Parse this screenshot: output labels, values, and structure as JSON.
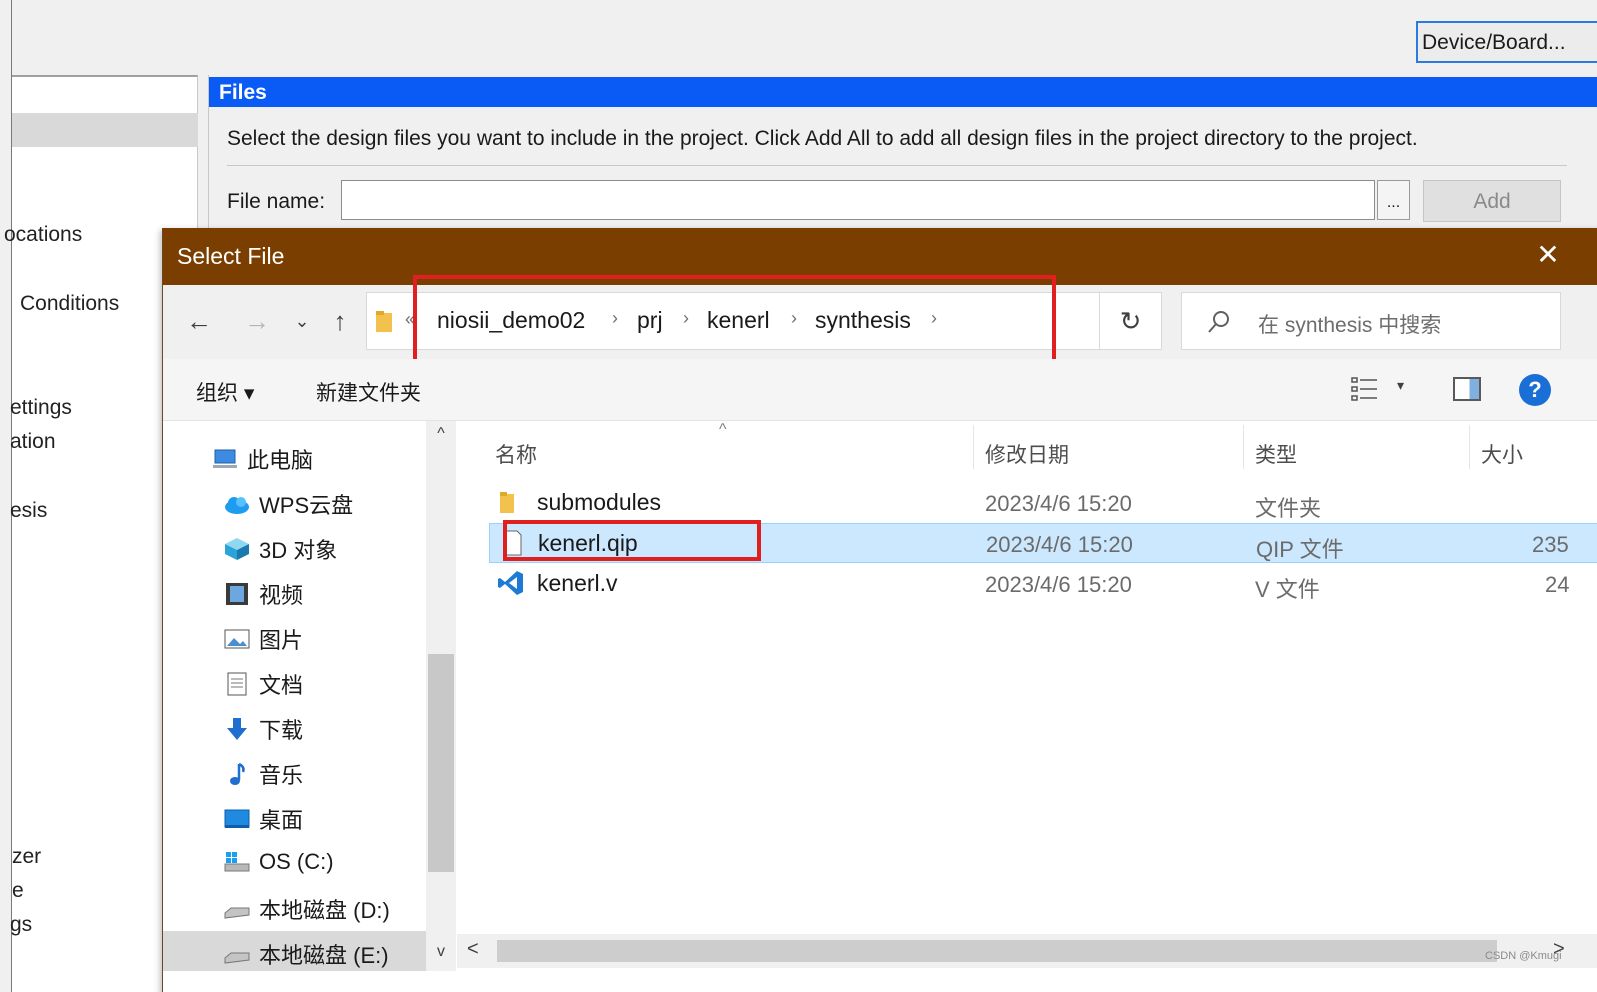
{
  "background": {
    "device_button": "Device/Board...",
    "sidebar_items": [
      "ocations",
      "Conditions",
      "ettings",
      "ation",
      "esis",
      "zer",
      "e",
      "gs"
    ],
    "files_title": "Files",
    "files_description": "Select the design files you want to include in the project. Click Add All to add all design files in the project directory to the project.",
    "file_name_label": "File name:",
    "file_name_value": "",
    "browse_label": "...",
    "add_label": "Add"
  },
  "dialog": {
    "title": "Select File",
    "close_glyph": "✕",
    "nav": {
      "back": "←",
      "forward": "→",
      "recent": "⌄",
      "up": "↑",
      "refresh": "↻",
      "dropdown": "⌄"
    },
    "breadcrumb": [
      "niosii_demo02",
      "prj",
      "kenerl",
      "synthesis"
    ],
    "breadcrumb_sep": "›",
    "breadcrumb_overflow": "«",
    "search_placeholder": "在 synthesis 中搜索",
    "toolbar": {
      "organize": "组织 ▾",
      "new_folder": "新建文件夹",
      "view_dropdown": "▾",
      "help": "?"
    },
    "nav_pane": [
      {
        "label": "此电脑",
        "icon": "computer-icon"
      },
      {
        "label": "WPS云盘",
        "icon": "cloud-icon"
      },
      {
        "label": "3D 对象",
        "icon": "3d-objects-icon"
      },
      {
        "label": "视频",
        "icon": "video-icon"
      },
      {
        "label": "图片",
        "icon": "pictures-icon"
      },
      {
        "label": "文档",
        "icon": "documents-icon"
      },
      {
        "label": "下载",
        "icon": "download-icon"
      },
      {
        "label": "音乐",
        "icon": "music-icon"
      },
      {
        "label": "桌面",
        "icon": "desktop-icon"
      },
      {
        "label": "OS (C:)",
        "icon": "os-drive-icon"
      },
      {
        "label": "本地磁盘 (D:)",
        "icon": "drive-icon"
      },
      {
        "label": "本地磁盘 (E:)",
        "icon": "drive-icon"
      }
    ],
    "columns": [
      "名称",
      "修改日期",
      "类型",
      "大小"
    ],
    "files": [
      {
        "name": "submodules",
        "date": "2023/4/6 15:20",
        "type": "文件夹",
        "size": "",
        "icon": "folder-icon"
      },
      {
        "name": "kenerl.qip",
        "date": "2023/4/6 15:20",
        "type": "QIP 文件",
        "size": "235",
        "icon": "file-icon",
        "selected": true
      },
      {
        "name": "kenerl.v",
        "date": "2023/4/6 15:20",
        "type": "V 文件",
        "size": "24",
        "icon": "vscode-icon"
      }
    ],
    "scroll": {
      "up": "^",
      "down": "v",
      "left": "<",
      "right": ">"
    }
  },
  "watermark": "CSDN @Kmugi",
  "colors": {
    "titlebar": "#7a3f00",
    "files_header": "#0a5af6",
    "selection": "#cce8ff",
    "highlight_box": "#e0201f"
  }
}
